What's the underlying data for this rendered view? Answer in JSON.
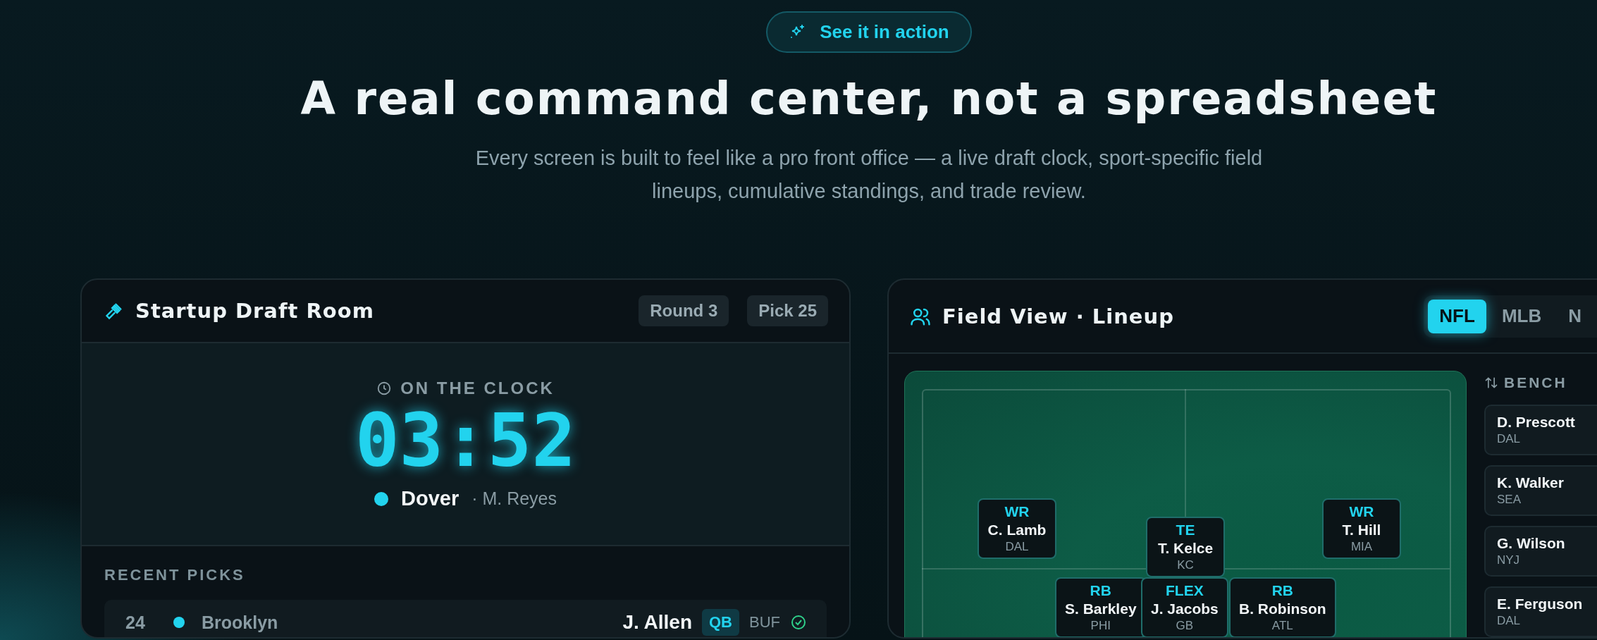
{
  "badge": {
    "label": "See it in action"
  },
  "heading": "A real command center, not a spreadsheet",
  "subheading": "Every screen is built to feel like a pro front office — a live draft clock, sport-specific field lineups, cumulative standings, and trade review.",
  "draft_room": {
    "title": "Startup Draft Room",
    "chips": [
      "Round 3",
      "Pick 25"
    ],
    "clock": {
      "label": "ON THE CLOCK",
      "time": "03:52",
      "team": "Dover",
      "manager": "· M. Reyes"
    },
    "recent_picks": {
      "label": "RECENT PICKS",
      "rows": [
        {
          "pick": "24",
          "team": "Brooklyn",
          "player": "J. Allen",
          "position": "QB",
          "pro_team": "BUF"
        }
      ]
    }
  },
  "field_view": {
    "title": "Field View · Lineup",
    "tabs": [
      {
        "label": "NFL",
        "selected": true
      },
      {
        "label": "MLB",
        "selected": false
      },
      {
        "label": "N",
        "selected": false
      }
    ],
    "lineup": [
      {
        "position": "WR",
        "name": "C. Lamb",
        "team": "DAL"
      },
      {
        "position": "TE",
        "name": "T. Kelce",
        "team": "KC"
      },
      {
        "position": "WR",
        "name": "T. Hill",
        "team": "MIA"
      },
      {
        "position": "RB",
        "name": "S. Barkley",
        "team": "PHI"
      },
      {
        "position": "FLEX",
        "name": "J. Jacobs",
        "team": "GB"
      },
      {
        "position": "RB",
        "name": "B. Robinson",
        "team": "ATL"
      }
    ],
    "bench": {
      "label": "BENCH",
      "players": [
        {
          "name": "D. Prescott",
          "team": "DAL"
        },
        {
          "name": "K. Walker",
          "team": "SEA"
        },
        {
          "name": "G. Wilson",
          "team": "NYJ"
        },
        {
          "name": "E. Ferguson",
          "team": "DAL"
        }
      ]
    }
  }
}
